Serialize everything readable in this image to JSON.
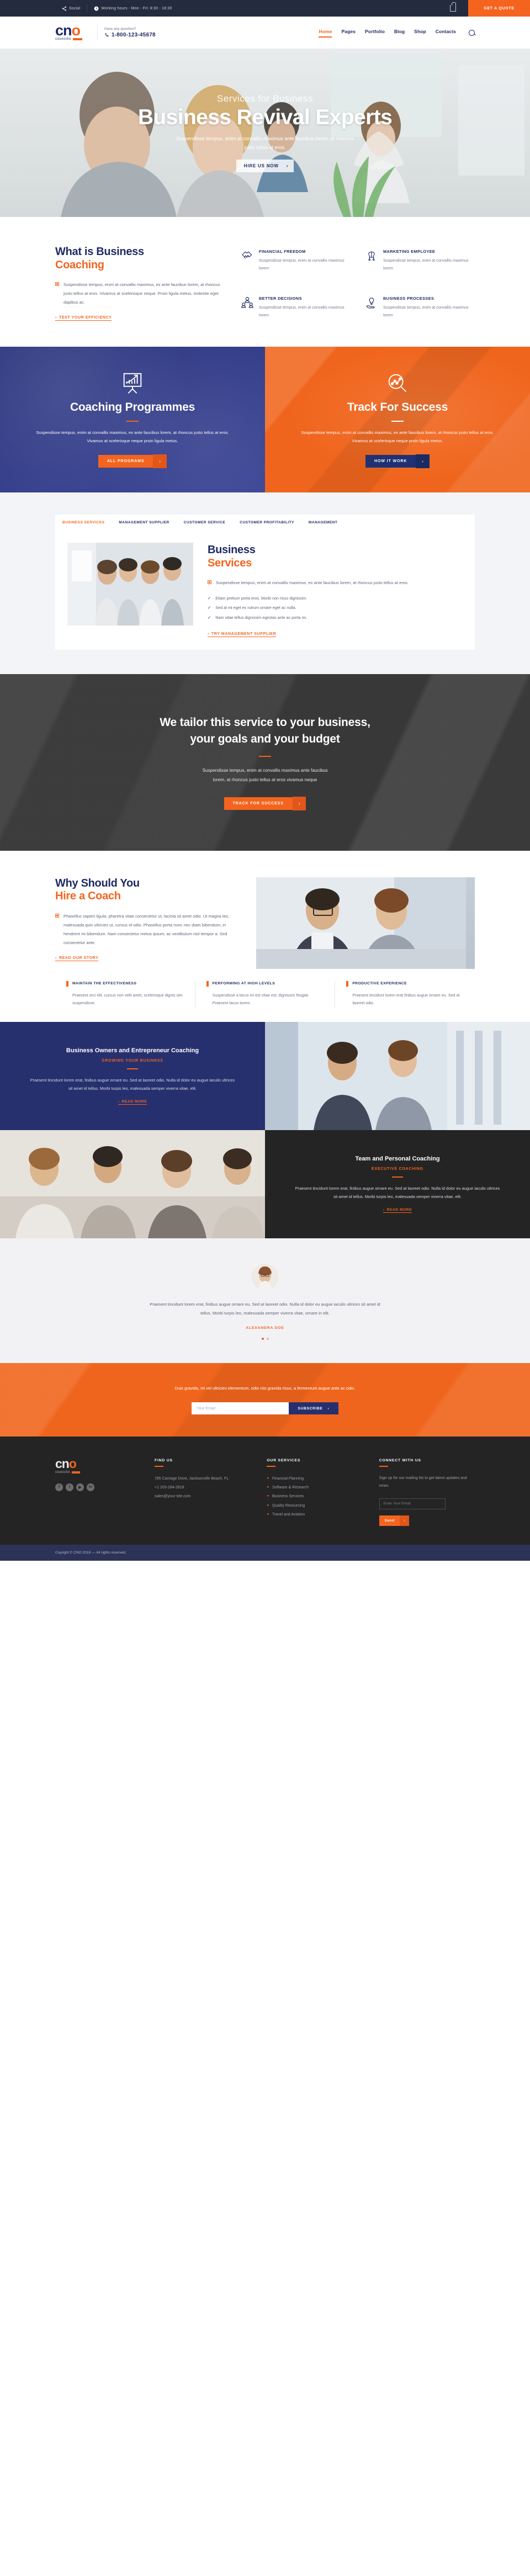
{
  "topbar": {
    "social_label": "Social",
    "hours": "Working hours - Mon - Fri: 8:30 - 18:30",
    "cart_icon": "bag-icon",
    "quote_button": "GET A QUOTE"
  },
  "brand": {
    "name_main": "cn",
    "name_o": "o",
    "name_sub": "councilio"
  },
  "header": {
    "question_label": "Have any question?",
    "phone": "1-800-123-45678",
    "nav": [
      {
        "label": "Home",
        "active": true
      },
      {
        "label": "Pages",
        "active": false
      },
      {
        "label": "Portfolio",
        "active": false
      },
      {
        "label": "Blog",
        "active": false
      },
      {
        "label": "Shop",
        "active": false
      },
      {
        "label": "Contacts",
        "active": false
      }
    ],
    "search_icon": "search-icon"
  },
  "hero": {
    "kicker": "Services for Business",
    "title": "Business Revival Experts",
    "subtitle": "Suspendisse tempus, enim at convallis maximus ante faucibus lorem, at rhoncus justo tellus at eros.",
    "button": "HIRE US NOW",
    "button_arrow": "›"
  },
  "what": {
    "title_line1": "What is Business",
    "title_line2": "Coaching",
    "paragraph": "Suspendisse tempus, enim at convallis maximus, ex ante faucibus lorem, at rhoncus justo tellus at eros. Vivamus at scelerisque neque. Proin ligula metus, molestie eget dapibus ac.",
    "link": "TEST YOUR EFFICIENCY",
    "features": [
      {
        "icon": "handshake-icon",
        "title": "FINANCIAL FREEDOM",
        "desc": "Suspendisse tempus, enim at convallis maximus lorem"
      },
      {
        "icon": "brain-network-icon",
        "title": "MARKETING EMPLOYEE",
        "desc": "Suspendisse tempus, enim at convallis maximus lorem"
      },
      {
        "icon": "people-group-icon",
        "title": "BETTER DECISIONS",
        "desc": "Suspendisse tempus, enim at convallis maximus lorem"
      },
      {
        "icon": "hand-bulb-icon",
        "title": "BUSINESS PROCESSES",
        "desc": "Suspendisse tempus, enim at convallis maximus lorem"
      }
    ]
  },
  "panels": {
    "left": {
      "icon": "chart-board-icon",
      "title": "Coaching Programmes",
      "desc": "Suspendisse tempus, enim at convallis maximus, ex ante faucibus lorem, at rhoncus justo tellus at eros. Vivamus at scelerisque neque proin ligula metus.",
      "button": "ALL PROGRAMS",
      "button_arrow": "›"
    },
    "right": {
      "icon": "magnifier-chart-icon",
      "title": "Track For Success",
      "desc": "Suspendisse tempus, enim at convallis maximus, ex ante faucibus lorem, at rhoncus justo tellus at eros. Vivamus at scelerisque neque proin ligula metus.",
      "button": "HOW IT WORK",
      "button_arrow": "›"
    }
  },
  "services": {
    "tabs": [
      {
        "label": "BUSINESS SERVICES",
        "active": true
      },
      {
        "label": "MANAGEMENT SUPPLIER",
        "active": false
      },
      {
        "label": "CUSTOMER SERVICE",
        "active": false
      },
      {
        "label": "CUSTOMER PROFITABILITY",
        "active": false
      },
      {
        "label": "MANAGEMENT",
        "active": false
      }
    ],
    "title_line1": "Business",
    "title_line2": "Services",
    "lead": "Suspendisse tempus, enim at convallis maximus, ex ante faucibus lorem, at rhoncus justo tellus at eros.",
    "checks": [
      "Etiam pretium porta eros. Morbi non risus dignissim.",
      "Sed at mi eget ex rutrum ornare eget ac nulla.",
      "Nam vitae tellus dignissim egestas ante ac porta mi."
    ],
    "link": "TRY MANAGEMENT SUPPLIER"
  },
  "tailor": {
    "title_line1": "We tailor this service to your business,",
    "title_line2": "your goals and your budget",
    "desc_line1": "Suspendisse tempus, enim at convallis maximus ante faucibus",
    "desc_line2": "lorem, at rhoncus justo tellus at eros vivamus neque",
    "button": "TRACK FOR SUCCESS",
    "button_arrow": "›"
  },
  "why": {
    "title_line1": "Why Should You",
    "title_line2": "Hire a Coach",
    "paragraph": "Phasellus sapien ligula, pharetra vitae consectetur ut, lacinia sit amet odio. Ut magna leo, malesuada quis ultricies ut, cursus id odio. Phasellus porta nunc nec diam bibendum, in hendrerit mi bibendum. Nam consectetur metus ipsum, ac vestibulum nisl tempor a. Sed consectetur ante.",
    "link": "READ OUR STORY",
    "cards": [
      {
        "title": "MAINTAIN THE EFFECTIVENESS",
        "desc": "Praesent orci elit, cursus non velit amet, scelerisque dignis sim suspendisse."
      },
      {
        "title": "PERFORMING AT HIGH LEVELS",
        "desc": "Suspendisse a lacus mi est vitae est, dignissim feugiat. Praesent lacus lorem."
      },
      {
        "title": "PRODUCTIVE EXPERIENCE",
        "desc": "Praesent tincidunt lorem erat finibus augue ornare eu. Sed at laoreet odio."
      }
    ]
  },
  "split": {
    "block1": {
      "title": "Business Owners and Entrepreneur Coaching",
      "kicker": "GROWING YOUR BUSINESS",
      "desc": "Praesent tincidunt lorem erat, finibus augue ornare eu. Sed at laoreet odio. Nulla id dolor eu augue iaculis ultrices sit amet id tellus. Morbi turpis leo, malesuada semper viverra vitae, elit.",
      "link": "READ MORE"
    },
    "block2": {
      "title": "Team and Personal Coaching",
      "kicker": "EXECUTIVE COACHING",
      "desc": "Praesent tincidunt lorem erat, finibus augue ornare eu. Sed at laoreet odio. Nulla id dolor eu augue iaculis ultrices sit amet id tellus. Morbi turpis leo, malesuada semper viverra vitae, elit.",
      "link": "READ MORE"
    }
  },
  "testimonial": {
    "avatar_icon": "person-avatar",
    "quote": "Praesent tincidunt lorem erat, finibus augue ornare eu. Sed at laoreet odio. Nulla id dolor eu augue iaculis ultrices sit amet id tellus. Morbi turpis leo, malesuada semper viverra vitae, ornare in elit.",
    "name": "ALEXANDRA DOE",
    "dots": 2,
    "active_dot": 0
  },
  "newsletter": {
    "text": "Duis gravida, mi vel ultricies elementum, odio nisi gravida risus, a fermentum augue ante ac odio.",
    "placeholder": "Your Email",
    "button": "SUBSCRIBE",
    "button_arrow": "›"
  },
  "footer": {
    "socials": [
      {
        "icon": "facebook-icon",
        "glyph": "f"
      },
      {
        "icon": "twitter-icon",
        "glyph": "t"
      },
      {
        "icon": "youtube-icon",
        "glyph": "▶"
      },
      {
        "icon": "linkedin-icon",
        "glyph": "in"
      }
    ],
    "col_find": {
      "heading": "FIND US",
      "address": "785 Carriage Drive, Jacksonville Beach, FL",
      "phone": "+1 203-284-2818",
      "email": "sales@your-site.com"
    },
    "col_services": {
      "heading": "OUR SERVICES",
      "items": [
        "Financial Planning",
        "Software & Research",
        "Business Services",
        "Quality Resourcing",
        "Travel and Aviation"
      ]
    },
    "col_connect": {
      "heading": "CONNECT WITH US",
      "note": "Sign up for our mailing list to get latest updates and news.",
      "placeholder": "Enter Your Email",
      "button": "Send",
      "button_arrow": "›"
    },
    "copyright": "Coyright © CNO 2018 — All rights reserved."
  },
  "colors": {
    "orange": "#f4641e",
    "navy": "#1f2a63",
    "blue_panel": "#3b4596",
    "dark": "#242424"
  }
}
